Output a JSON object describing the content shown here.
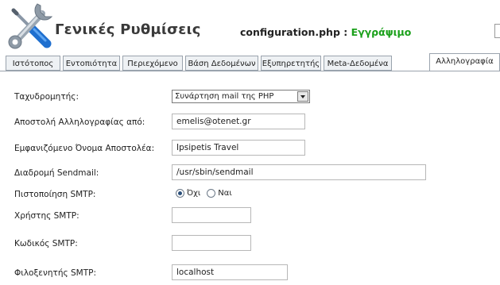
{
  "header": {
    "title": "Γενικές Ρυθμίσεις",
    "config_file": "configuration.php",
    "config_separator": " : ",
    "config_state": "Εγγράψιμο"
  },
  "tabs": [
    {
      "label": "Ιστότοπος",
      "active": false
    },
    {
      "label": "Εντοπιότητα",
      "active": false
    },
    {
      "label": "Περιεχόμενο",
      "active": false
    },
    {
      "label": "Βάση Δεδομένων",
      "active": false
    },
    {
      "label": "Εξυπηρετητής",
      "active": false
    },
    {
      "label": "Meta-Δεδομένα",
      "active": false
    },
    {
      "label": "Αλληλογραφία",
      "active": true
    }
  ],
  "mail": {
    "mailer_label": "Ταχυδρομητής:",
    "mailer_value": "Συνάρτηση mail της PHP",
    "from_label": "Αποστολή Αλληλογραφίας από:",
    "from_value": "emelis@otenet.gr",
    "fromname_label": "Εμφανιζόμενο Όνομα Αποστολέα:",
    "fromname_value": "Ipsipetis Travel",
    "sendmail_label": "Διαδρομή Sendmail:",
    "sendmail_value": "/usr/sbin/sendmail",
    "smtpauth_label": "Πιστοποίηση SMTP:",
    "smtpauth_options": [
      "Όχι",
      "Ναι"
    ],
    "smtpauth_selected": "Όχι",
    "smtpuser_label": "Χρήστης SMTP:",
    "smtpuser_value": "",
    "smtppass_label": "Κωδικός SMTP:",
    "smtppass_value": "",
    "smtphost_label": "Φιλοξενητής SMTP:",
    "smtphost_value": "localhost"
  },
  "colors": {
    "state_green": "#1aa01a",
    "tab_border": "#9aa3ad",
    "tab_bg": "#eef1f4"
  },
  "icons": {
    "logo": "wrench-screwdriver-icon"
  }
}
